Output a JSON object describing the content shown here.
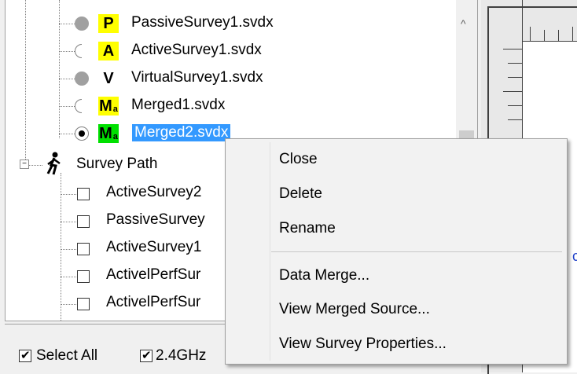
{
  "tree": {
    "items": [
      {
        "badge": "P",
        "label": "PassiveSurvey1.svdx"
      },
      {
        "badge": "A",
        "label": "ActiveSurvey1.svdx"
      },
      {
        "badge": "V",
        "label": "VirtualSurvey1.svdx"
      },
      {
        "badge": "M",
        "badge_sub": "a",
        "label": "Merged1.svdx"
      },
      {
        "badge": "M",
        "badge_sub": "a",
        "label": "Merged2.svdx"
      }
    ],
    "survey_path": {
      "label": "Survey Path",
      "expander": "−",
      "items": [
        {
          "label": "ActiveSurvey2"
        },
        {
          "label": "PassiveSurvey"
        },
        {
          "label": "ActiveSurvey1"
        },
        {
          "label": "ActivelPerfSur"
        },
        {
          "label": "ActivelPerfSur"
        }
      ]
    },
    "scroll_up_arrow": "^"
  },
  "bottom_bar": {
    "select_all_label": "Select All",
    "band_label": "2.4GHz"
  },
  "context_menu": {
    "items": [
      {
        "label": "Close"
      },
      {
        "label": "Delete"
      },
      {
        "label": "Rename"
      },
      {
        "label": "Data Merge..."
      },
      {
        "label": "View Merged Source..."
      },
      {
        "label": "View Survey Properties..."
      }
    ]
  },
  "right_panel": {
    "clipped_text": "c"
  },
  "colors": {
    "selection": "#3399ff",
    "badge_yellow": "#ffff00",
    "badge_green": "#00e000"
  }
}
